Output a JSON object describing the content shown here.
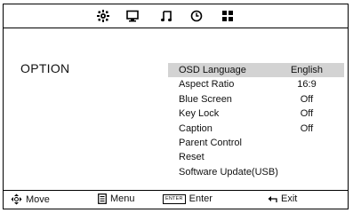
{
  "tabs": [
    {
      "icon": "picture-settings-icon"
    },
    {
      "icon": "monitor-icon"
    },
    {
      "icon": "music-note-icon"
    },
    {
      "icon": "clock-icon"
    },
    {
      "icon": "grid-icon"
    }
  ],
  "section_title": "OPTION",
  "menu": {
    "items": [
      {
        "label": "OSD Language",
        "value": "English",
        "selected": true
      },
      {
        "label": "Aspect Ratio",
        "value": "16:9"
      },
      {
        "label": "Blue Screen",
        "value": "Off"
      },
      {
        "label": "Key Lock",
        "value": "Off"
      },
      {
        "label": "Caption",
        "value": "Off"
      },
      {
        "label": "Parent Control",
        "value": ""
      },
      {
        "label": "Reset",
        "value": ""
      },
      {
        "label": "Software Update(USB)",
        "value": ""
      }
    ]
  },
  "footer": {
    "move_label": "Move",
    "menu_label": "Menu",
    "enter_key": "ENTER",
    "enter_label": "Enter",
    "exit_label": "Exit"
  },
  "colors": {
    "highlight": "#d3d3d3",
    "border": "#000000"
  }
}
